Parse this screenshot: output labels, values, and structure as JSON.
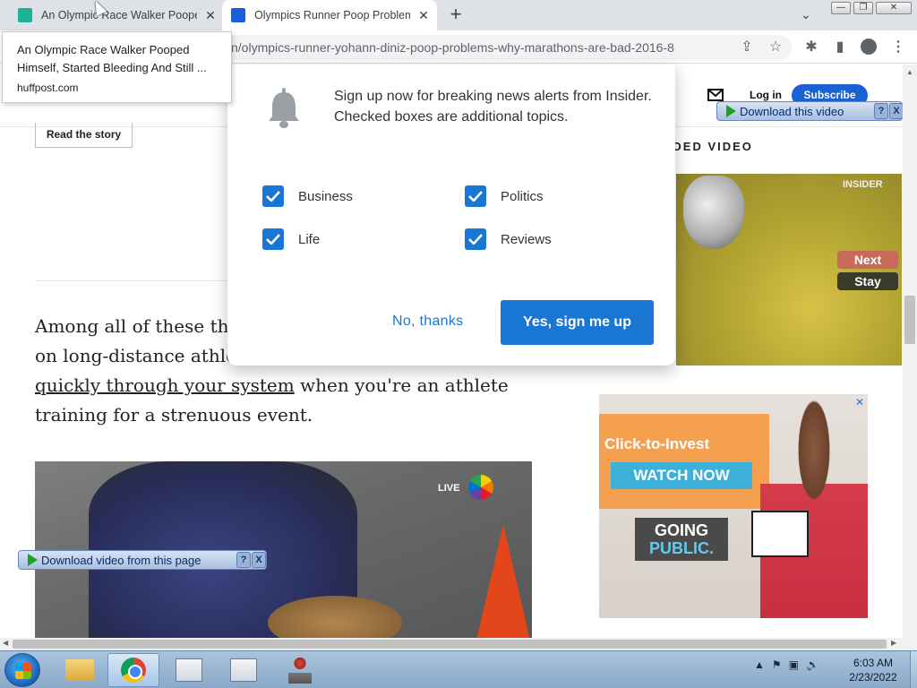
{
  "browser": {
    "tabs": [
      {
        "title": "An Olympic Race Walker Pooped",
        "close_glyph": "✕"
      },
      {
        "title": "Olympics Runner Poop Problems",
        "close_glyph": "✕"
      }
    ],
    "new_tab_glyph": "+",
    "url": "n/olympics-runner-yohann-diniz-poop-problems-why-marathons-are-bad-2016-8",
    "icons": [
      "share-icon",
      "star-icon",
      "extensions-icon",
      "side-panel-icon",
      "profile-icon",
      "menu-icon"
    ]
  },
  "tooltip": {
    "title": "An Olympic Race Walker Pooped Himself, Started Bleeding And Still ...",
    "domain": "huffpost.com"
  },
  "site": {
    "login": "Log in",
    "subscribe": "Subscribe",
    "read_story": "Read the story",
    "rec_heading": "NDED VIDEO",
    "video_next": "Next",
    "video_stay": "Stay",
    "video_watermark": "INSIDER"
  },
  "article": {
    "line1": "Among all of these theo",
    "line2_start": "on long-distance athlet",
    "line3_link": "quickly through your system",
    "line3_rest": " when you're an athlete",
    "line4": "training for a strenuous event.",
    "video_live": "LIVE",
    "video_network": "NBC"
  },
  "download_bars": {
    "top_label": "Download this video",
    "bottom_label": "Download video from this page",
    "help": "?",
    "close": "X"
  },
  "ad": {
    "headline": "Click-to-Invest",
    "cta": "WATCH NOW",
    "show_line1": "GOING",
    "show_line2": "PUBLIC.",
    "close": "✕"
  },
  "modal": {
    "message": "Sign up now for breaking news alerts from Insider. Checked boxes are additional topics.",
    "topics": [
      {
        "label": "Business",
        "checked": true
      },
      {
        "label": "Politics",
        "checked": true
      },
      {
        "label": "Life",
        "checked": true
      },
      {
        "label": "Reviews",
        "checked": true
      }
    ],
    "decline": "No, thanks",
    "accept": "Yes, sign me up"
  },
  "taskbar": {
    "time": "6:03 AM",
    "date": "2/23/2022",
    "tray_arrow": "▲"
  },
  "colors": {
    "accent_blue": "#1976d2",
    "subscribe_blue": "#1a60d6"
  }
}
